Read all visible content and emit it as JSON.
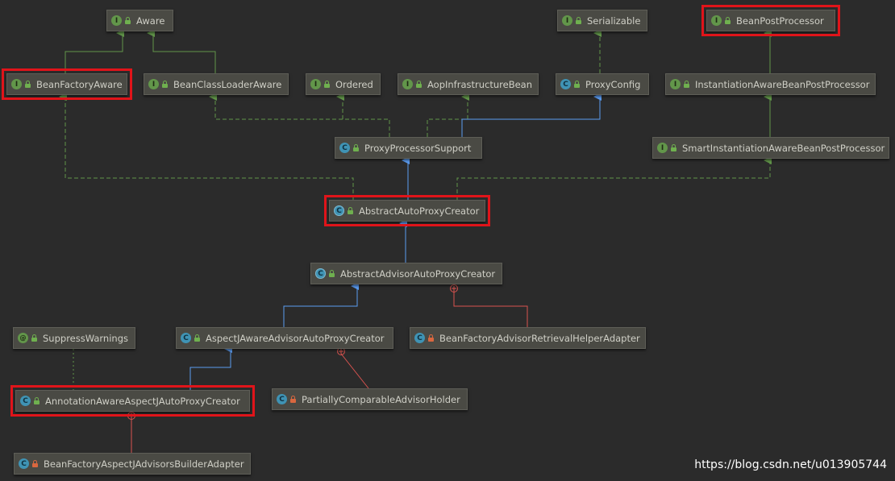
{
  "nodes": {
    "aware": {
      "label": "Aware",
      "kind": "I"
    },
    "serializable": {
      "label": "Serializable",
      "kind": "I"
    },
    "bean_post_processor": {
      "label": "BeanPostProcessor",
      "kind": "I"
    },
    "bean_factory_aware": {
      "label": "BeanFactoryAware",
      "kind": "I"
    },
    "bean_class_loader_aware": {
      "label": "BeanClassLoaderAware",
      "kind": "I"
    },
    "ordered": {
      "label": "Ordered",
      "kind": "I"
    },
    "aop_infrastructure_bean": {
      "label": "AopInfrastructureBean",
      "kind": "I"
    },
    "proxy_config": {
      "label": "ProxyConfig",
      "kind": "C"
    },
    "instantiation_aware_bpp": {
      "label": "InstantiationAwareBeanPostProcessor",
      "kind": "I"
    },
    "proxy_processor_support": {
      "label": "ProxyProcessorSupport",
      "kind": "C"
    },
    "smart_instantiation_aware_bpp": {
      "label": "SmartInstantiationAwareBeanPostProcessor",
      "kind": "I"
    },
    "abstract_auto_proxy_creator": {
      "label": "AbstractAutoProxyCreator",
      "kind": "C"
    },
    "abstract_advisor_auto_proxy_creator": {
      "label": "AbstractAdvisorAutoProxyCreator",
      "kind": "C"
    },
    "suppress_warnings": {
      "label": "SuppressWarnings",
      "kind": "@"
    },
    "aspectj_aware_advisor_auto_proxy_creator": {
      "label": "AspectJAwareAdvisorAutoProxyCreator",
      "kind": "C"
    },
    "bean_factory_advisor_retrieval_helper_adapter": {
      "label": "BeanFactoryAdvisorRetrievalHelperAdapter",
      "kind": "C"
    },
    "annotation_aware_aspectj_auto_proxy_creator": {
      "label": "AnnotationAwareAspectJAutoProxyCreator",
      "kind": "C"
    },
    "partially_comparable_advisor_holder": {
      "label": "PartiallyComparableAdvisorHolder",
      "kind": "C"
    },
    "bean_factory_aspectj_advisors_builder_adapter": {
      "label": "BeanFactoryAspectJAdvisorsBuilderAdapter",
      "kind": "C"
    }
  },
  "watermark": "https://blog.csdn.net/u013905744",
  "colors": {
    "background": "#2b2b2b",
    "node_fill": "#4a4a44",
    "node_text": "#cfcfc6",
    "interface_edge": "#62964a",
    "extends_edge": "#5b9cf0",
    "inner_edge": "#d9534f",
    "highlight": "#e0141a"
  }
}
